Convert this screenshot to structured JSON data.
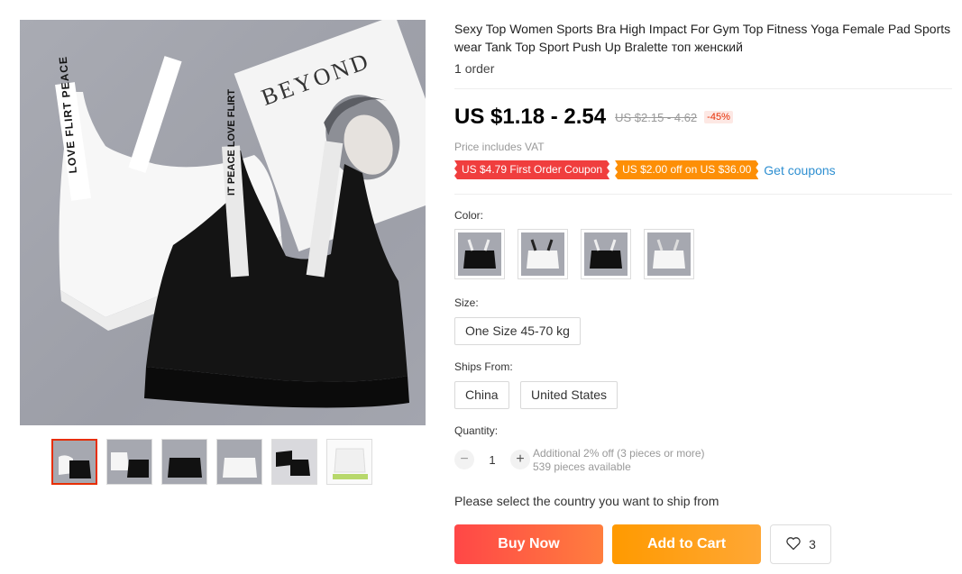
{
  "product": {
    "title": "Sexy Top Women Sports Bra High Impact For Gym Top Fitness Yoga Female Pad Sportswear Tank Top Sport Push Up Bralette топ женский",
    "orders_count": "1",
    "orders_label": "order"
  },
  "gallery": {
    "main_image_alt": "Black and white sports bras on gray background",
    "magazine_text": "BEYOND",
    "strap_text_1": "LOVE FLIRT PEACE",
    "strap_text_2": "IT PEACE LOVE FLIRT",
    "thumbnail_count": 6
  },
  "price": {
    "current": "US $1.18 - 2.54",
    "original": "US $2.15 - 4.62",
    "discount": "-45%",
    "vat_note": "Price includes VAT"
  },
  "coupons": {
    "first_order": "US $4.79 First Order Coupon",
    "threshold": "US $2.00 off on US $36.00",
    "get_link": "Get coupons"
  },
  "color": {
    "label": "Color:"
  },
  "size": {
    "label": "Size:",
    "options": [
      "One Size 45-70 kg"
    ]
  },
  "ships_from": {
    "label": "Ships From:",
    "options": [
      "China",
      "United States"
    ]
  },
  "quantity": {
    "label": "Quantity:",
    "minus": "−",
    "value": "1",
    "plus": "+",
    "discount_note": "Additional 2% off (3 pieces or more)",
    "available": "539 pieces available"
  },
  "shipping_message": "Please select the country you want to ship from",
  "actions": {
    "buy_now": "Buy Now",
    "add_to_cart": "Add to Cart",
    "wishlist_count": "3"
  },
  "colors": {
    "accent_red": "#e62e04",
    "buy_gradient_start": "#ff4747",
    "cart_orange": "#ff9a00",
    "link_blue": "#2e8fd1"
  }
}
